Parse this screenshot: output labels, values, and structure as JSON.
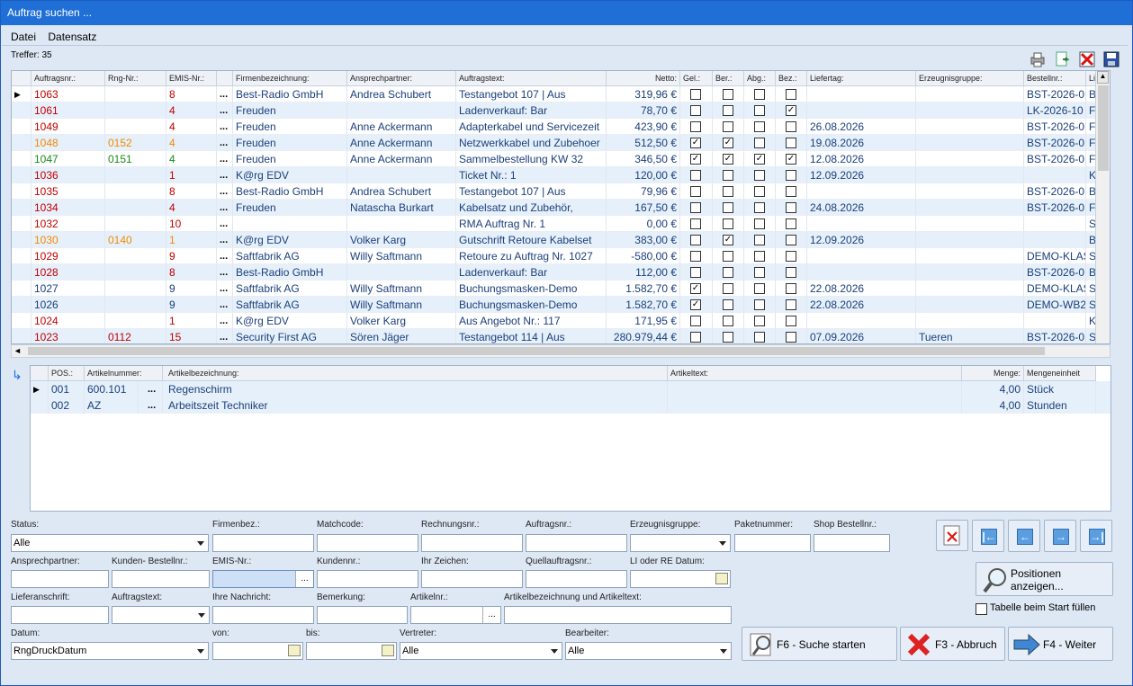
{
  "window": {
    "title": "Auftrag suchen ..."
  },
  "menu": {
    "file": "Datei",
    "record": "Datensatz"
  },
  "hits": "Treffer: 35",
  "grid1": {
    "headers": [
      "Auftragsnr.:",
      "Rng-Nr.:",
      "EMIS-Nr.:",
      "Firmenbezeichnung:",
      "Ansprechpartner:",
      "Auftragstext:",
      "Netto:",
      "Gel.:",
      "Ber.:",
      "Abg.:",
      "Bez.:",
      "Liefertag:",
      "Erzeugnisgruppe:",
      "Bestellnr.:",
      "Li"
    ],
    "rows": [
      {
        "nr": "1063",
        "rng": "",
        "emis": "8",
        "firma": "Best-Radio GmbH",
        "ansp": "Andrea Schubert",
        "text": "Testangebot 107 | Aus",
        "netto": "319,96 €",
        "gel": false,
        "ber": false,
        "abg": false,
        "bez": false,
        "liefertag": "",
        "gruppe": "",
        "bestell": "BST-2026-0",
        "li": "B"
      },
      {
        "nr": "1061",
        "rng": "",
        "emis": "4",
        "firma": "Freuden",
        "ansp": "",
        "text": "Ladenverkauf: Bar",
        "netto": "78,70 €",
        "gel": false,
        "ber": false,
        "abg": false,
        "bez": true,
        "liefertag": "",
        "gruppe": "",
        "bestell": "LK-2026-10",
        "li": "Fr"
      },
      {
        "nr": "1049",
        "rng": "",
        "emis": "4",
        "firma": "Freuden",
        "ansp": "Anne Ackermann",
        "text": "Adapterkabel und Servicezeit",
        "netto": "423,90 €",
        "gel": false,
        "ber": false,
        "abg": false,
        "bez": false,
        "liefertag": "26.08.2026",
        "gruppe": "",
        "bestell": "BST-2026-0",
        "li": "Fr"
      },
      {
        "nr": "1048",
        "rng": "0152",
        "emis": "4",
        "firma": "Freuden",
        "ansp": "Anne Ackermann",
        "text": "Netzwerkkabel und Zubehoer",
        "netto": "512,50 €",
        "gel": true,
        "ber": true,
        "abg": false,
        "bez": false,
        "liefertag": "19.08.2026",
        "gruppe": "",
        "bestell": "BST-2026-0",
        "li": "Fr"
      },
      {
        "nr": "1047",
        "rng": "0151",
        "emis": "4",
        "firma": "Freuden",
        "ansp": "Anne Ackermann",
        "text": "Sammelbestellung KW 32",
        "netto": "346,50 €",
        "gel": true,
        "ber": true,
        "abg": true,
        "bez": true,
        "liefertag": "12.08.2026",
        "gruppe": "",
        "bestell": "BST-2026-0",
        "li": "Fr"
      },
      {
        "nr": "1036",
        "rng": "",
        "emis": "1",
        "firma": "K@rg EDV",
        "ansp": "",
        "text": "Ticket Nr.: 1",
        "netto": "120,00 €",
        "gel": false,
        "ber": false,
        "abg": false,
        "bez": false,
        "liefertag": "12.09.2026",
        "gruppe": "",
        "bestell": "",
        "li": "K"
      },
      {
        "nr": "1035",
        "rng": "",
        "emis": "8",
        "firma": "Best-Radio GmbH",
        "ansp": "Andrea Schubert",
        "text": "Testangebot 107 | Aus",
        "netto": "79,96 €",
        "gel": false,
        "ber": false,
        "abg": false,
        "bez": false,
        "liefertag": "",
        "gruppe": "",
        "bestell": "BST-2026-0",
        "li": "B"
      },
      {
        "nr": "1034",
        "rng": "",
        "emis": "4",
        "firma": "Freuden",
        "ansp": "Natascha Burkart",
        "text": "Kabelsatz und Zubehör,",
        "netto": "167,50 €",
        "gel": false,
        "ber": false,
        "abg": false,
        "bez": false,
        "liefertag": "24.08.2026",
        "gruppe": "",
        "bestell": "BST-2026-0",
        "li": "Fr"
      },
      {
        "nr": "1032",
        "rng": "",
        "emis": "10",
        "firma": "",
        "ansp": "",
        "text": "RMA Auftrag Nr. 1",
        "netto": "0,00 €",
        "gel": false,
        "ber": false,
        "abg": false,
        "bez": false,
        "liefertag": "",
        "gruppe": "",
        "bestell": "",
        "li": "Sp"
      },
      {
        "nr": "1030",
        "rng": "0140",
        "emis": "1",
        "firma": "K@rg EDV",
        "ansp": "Volker Karg",
        "text": "Gutschrift Retoure Kabelset",
        "netto": "383,00 €",
        "gel": false,
        "ber": true,
        "abg": false,
        "bez": false,
        "liefertag": "12.09.2026",
        "gruppe": "",
        "bestell": "",
        "li": "B"
      },
      {
        "nr": "1029",
        "rng": "",
        "emis": "9",
        "firma": "Saftfabrik AG",
        "ansp": "Willy Saftmann",
        "text": "Retoure zu Auftrag Nr. 1027",
        "netto": "-580,00 €",
        "gel": false,
        "ber": false,
        "abg": false,
        "bez": false,
        "liefertag": "",
        "gruppe": "",
        "bestell": "DEMO-KLAS",
        "li": "Sa"
      },
      {
        "nr": "1028",
        "rng": "",
        "emis": "8",
        "firma": "Best-Radio GmbH",
        "ansp": "",
        "text": "Ladenverkauf: Bar",
        "netto": "112,00 €",
        "gel": false,
        "ber": false,
        "abg": false,
        "bez": false,
        "liefertag": "",
        "gruppe": "",
        "bestell": "BST-2026-0",
        "li": "B"
      },
      {
        "nr": "1027",
        "rng": "",
        "emis": "9",
        "firma": "Saftfabrik AG",
        "ansp": "Willy Saftmann",
        "text": "Buchungsmasken-Demo",
        "netto": "1.582,70 €",
        "gel": true,
        "ber": false,
        "abg": false,
        "bez": false,
        "liefertag": "22.08.2026",
        "gruppe": "",
        "bestell": "DEMO-KLAS",
        "li": "Sa"
      },
      {
        "nr": "1026",
        "rng": "",
        "emis": "9",
        "firma": "Saftfabrik AG",
        "ansp": "Willy Saftmann",
        "text": "Buchungsmasken-Demo",
        "netto": "1.582,70 €",
        "gel": true,
        "ber": false,
        "abg": false,
        "bez": false,
        "liefertag": "22.08.2026",
        "gruppe": "",
        "bestell": "DEMO-WB2",
        "li": "Sa"
      },
      {
        "nr": "1024",
        "rng": "",
        "emis": "1",
        "firma": "K@rg EDV",
        "ansp": "Volker Karg",
        "text": "Aus Angebot Nr.: 117",
        "netto": "171,95 €",
        "gel": false,
        "ber": false,
        "abg": false,
        "bez": false,
        "liefertag": "",
        "gruppe": "",
        "bestell": "",
        "li": "K"
      },
      {
        "nr": "1023",
        "rng": "0112",
        "emis": "15",
        "firma": "Security First AG",
        "ansp": "Sören Jäger",
        "text": "Testangebot 114 | Aus",
        "netto": "280.979,44 €",
        "gel": false,
        "ber": false,
        "abg": false,
        "bez": false,
        "liefertag": "07.09.2026",
        "gruppe": "Tueren",
        "bestell": "BST-2026-0",
        "li": "Se"
      }
    ],
    "colors": {
      "1063": "red",
      "1061": "red",
      "1049": "red",
      "1048": "orange",
      "1047": "green",
      "1036": "red",
      "1035": "red",
      "1034": "red",
      "1032": "red",
      "1030": "orange",
      "1029": "red",
      "1028": "red",
      "1027": "blue",
      "1026": "blue",
      "1024": "red",
      "1023": "red"
    }
  },
  "grid2": {
    "headers": [
      "POS.:",
      "Artikelnummer:",
      "Artikelbezeichnung:",
      "Artikeltext:",
      "Menge:",
      "Mengeneinheit"
    ],
    "rows": [
      {
        "pos": "001",
        "art": "600.101",
        "bez": "Regenschirm",
        "text": "",
        "menge": "4,00",
        "einheit": "Stück"
      },
      {
        "pos": "002",
        "art": "AZ",
        "bez": "Arbeitszeit Techniker",
        "text": "",
        "menge": "4,00",
        "einheit": "Stunden"
      }
    ]
  },
  "form": {
    "status_label": "Status:",
    "status_value": "Alle",
    "firmenbez": "Firmenbez.:",
    "matchcode": "Matchcode:",
    "rechnungsnr": "Rechnungsnr.:",
    "auftragsnr": "Auftragsnr.:",
    "erzeugnisgruppe": "Erzeugnisgruppe:",
    "paketnummer": "Paketnummer:",
    "shopbestellnr": "Shop Bestellnr.:",
    "ansprechpartner": "Ansprechpartner:",
    "kundenbestellnr": "Kunden- Bestellnr.:",
    "emisnr": "EMIS-Nr.:",
    "kundennr": "Kundennr.:",
    "ihrzeichen": "Ihr Zeichen:",
    "quellauftragsnr": "Quellauftragsnr.:",
    "lirdatum": "LI oder RE Datum:",
    "lieferanschrift": "Lieferanschrift:",
    "auftragstext": "Auftragstext:",
    "ihrenachricht": "Ihre Nachricht:",
    "bemerkung": "Bemerkung:",
    "artikelnr": "Artikelnr.:",
    "artikelbez": "Artikelbezeichnung und Artikeltext:",
    "datum_label": "Datum:",
    "datum_value": "RngDruckDatum",
    "von": "von:",
    "bis": "bis:",
    "vertreter_label": "Vertreter:",
    "vertreter_value": "Alle",
    "bearbeiter_label": "Bearbeiter:",
    "bearbeiter_value": "Alle",
    "positionen_line1": "Positionen",
    "positionen_line2": "anzeigen...",
    "fill_table": "Tabelle beim Start füllen",
    "f6": "F6 - Suche starten",
    "f3": "F3 - Abbruch",
    "f4": "F4 - Weiter"
  }
}
